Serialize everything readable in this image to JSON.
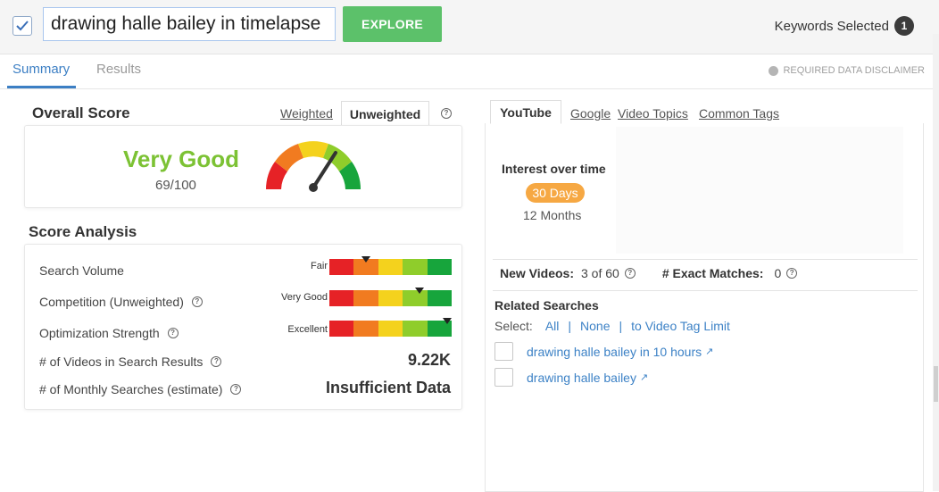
{
  "search": {
    "value": "drawing halle bailey in timelapse",
    "checked": true
  },
  "explore_label": "EXPLORE",
  "keywords_selected": {
    "label": "Keywords Selected",
    "count": "1"
  },
  "tabs": {
    "summary": "Summary",
    "results": "Results"
  },
  "disclaimer": "REQUIRED DATA DISCLAIMER",
  "overall": {
    "title": "Overall Score",
    "weighted_label": "Weighted",
    "unweighted_label": "Unweighted",
    "score_label": "Very Good",
    "score_value": "69/100",
    "score": 69,
    "score_color": "#7cc234"
  },
  "analysis": {
    "title": "Score Analysis",
    "metrics": [
      {
        "label": "Search Volume",
        "rating": "Fair",
        "level": 0.3,
        "help": false
      },
      {
        "label": "Competition (Unweighted)",
        "rating": "Very Good",
        "level": 0.74,
        "help": true
      },
      {
        "label": "Optimization Strength",
        "rating": "Excellent",
        "level": 0.96,
        "help": true
      }
    ],
    "videos_label": "# of Videos in Search Results",
    "videos_value": "9.22K",
    "monthly_label": "# of Monthly Searches (estimate)",
    "monthly_value": "Insufficient Data",
    "bar_colors": [
      "#e62226",
      "#f17b20",
      "#f4d21d",
      "#8fcd2b",
      "#17a53c"
    ]
  },
  "right_tabs": {
    "youtube": "YouTube",
    "google": "Google",
    "video_topics": "Video Topics",
    "common_tags": "Common Tags"
  },
  "interest": {
    "title": "Interest over time",
    "days": "30 Days",
    "months": "12 Months"
  },
  "stats": {
    "new_videos_label": "New Videos:",
    "new_videos_value": "3 of 60",
    "exact_label": "# Exact Matches:",
    "exact_value": "0"
  },
  "related": {
    "title": "Related Searches",
    "select_label": "Select:",
    "all": "All",
    "none": "None",
    "to_limit": "to Video Tag Limit",
    "items": [
      "drawing halle bailey in 10 hours",
      "drawing halle bailey"
    ]
  }
}
